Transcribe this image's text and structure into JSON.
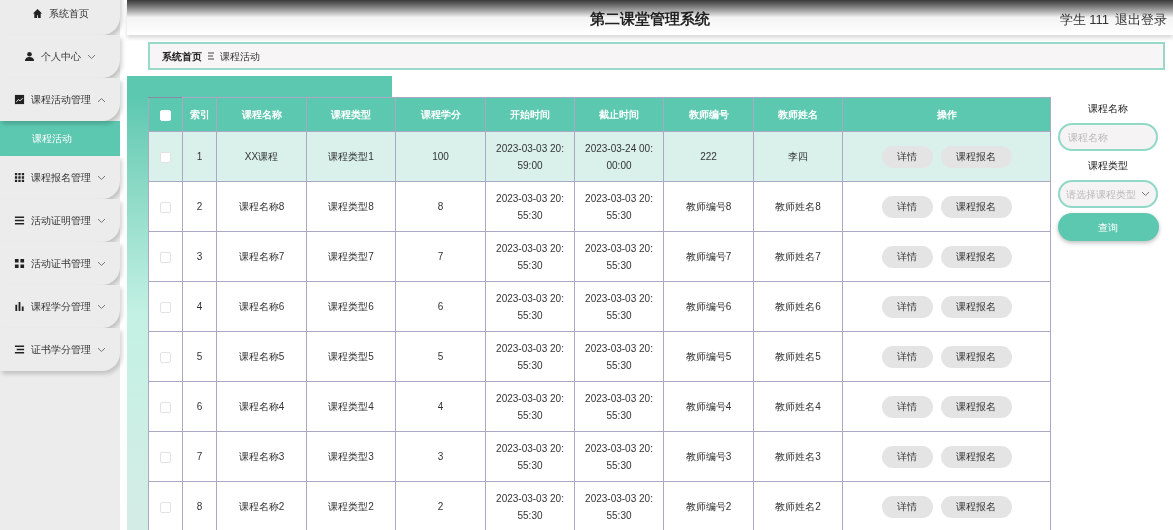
{
  "header": {
    "title": "第二课堂管理系统",
    "user": "学生 111",
    "logout": "退出登录"
  },
  "sidebar": {
    "items": [
      {
        "kind": "link",
        "label": "系统首页"
      },
      {
        "kind": "group",
        "label": "个人中心",
        "expanded": false
      },
      {
        "kind": "group",
        "label": "课程活动管理",
        "expanded": true,
        "children": [
          {
            "label": "课程活动",
            "selected": true
          }
        ]
      },
      {
        "kind": "group",
        "label": "课程报名管理",
        "expanded": false
      },
      {
        "kind": "group",
        "label": "活动证明管理",
        "expanded": false
      },
      {
        "kind": "group",
        "label": "活动证书管理",
        "expanded": false
      },
      {
        "kind": "group",
        "label": "课程学分管理",
        "expanded": false
      },
      {
        "kind": "group",
        "label": "证书学分管理",
        "expanded": false
      }
    ]
  },
  "breadcrumb": [
    "系统首页",
    "课程活动"
  ],
  "table": {
    "select_all": {
      "checked": false
    },
    "columns": [
      "索引",
      "课程名称",
      "课程类型",
      "课程学分",
      "开始时间",
      "截止时间",
      "教师编号",
      "教师姓名",
      "操作"
    ],
    "rows": [
      {
        "selected": true,
        "checked": false,
        "cells": [
          "1",
          "XX课程",
          "课程类型1",
          "100",
          "2023-03-03 20:59:00",
          "2023-03-24 00:00:00",
          "222",
          "李四"
        ],
        "actions": [
          "详情",
          "课程报名"
        ]
      },
      {
        "selected": false,
        "checked": false,
        "cells": [
          "2",
          "课程名称8",
          "课程类型8",
          "8",
          "2023-03-03 20:55:30",
          "2023-03-03 20:55:30",
          "教师编号8",
          "教师姓名8"
        ],
        "actions": [
          "详情",
          "课程报名"
        ]
      },
      {
        "selected": false,
        "checked": false,
        "cells": [
          "3",
          "课程名称7",
          "课程类型7",
          "7",
          "2023-03-03 20:55:30",
          "2023-03-03 20:55:30",
          "教师编号7",
          "教师姓名7"
        ],
        "actions": [
          "详情",
          "课程报名"
        ]
      },
      {
        "selected": false,
        "checked": false,
        "cells": [
          "4",
          "课程名称6",
          "课程类型6",
          "6",
          "2023-03-03 20:55:30",
          "2023-03-03 20:55:30",
          "教师编号6",
          "教师姓名6"
        ],
        "actions": [
          "详情",
          "课程报名"
        ]
      },
      {
        "selected": false,
        "checked": false,
        "cells": [
          "5",
          "课程名称5",
          "课程类型5",
          "5",
          "2023-03-03 20:55:30",
          "2023-03-03 20:55:30",
          "教师编号5",
          "教师姓名5"
        ],
        "actions": [
          "详情",
          "课程报名"
        ]
      },
      {
        "selected": false,
        "checked": false,
        "cells": [
          "6",
          "课程名称4",
          "课程类型4",
          "4",
          "2023-03-03 20:55:30",
          "2023-03-03 20:55:30",
          "教师编号4",
          "教师姓名4"
        ],
        "actions": [
          "详情",
          "课程报名"
        ]
      },
      {
        "selected": false,
        "checked": false,
        "cells": [
          "7",
          "课程名称3",
          "课程类型3",
          "3",
          "2023-03-03 20:55:30",
          "2023-03-03 20:55:30",
          "教师编号3",
          "教师姓名3"
        ],
        "actions": [
          "详情",
          "课程报名"
        ]
      },
      {
        "selected": false,
        "checked": false,
        "cells": [
          "8",
          "课程名称2",
          "课程类型2",
          "2",
          "2023-03-03 20:55:30",
          "2023-03-03 20:55:30",
          "教师编号2",
          "教师姓名2"
        ],
        "actions": [
          "详情",
          "课程报名"
        ]
      }
    ]
  },
  "search": {
    "fields": [
      {
        "kind": "input",
        "label": "课程名称",
        "placeholder": "课程名称"
      },
      {
        "kind": "select",
        "label": "课程类型",
        "placeholder": "请选择课程类型"
      }
    ],
    "button": "查询"
  }
}
